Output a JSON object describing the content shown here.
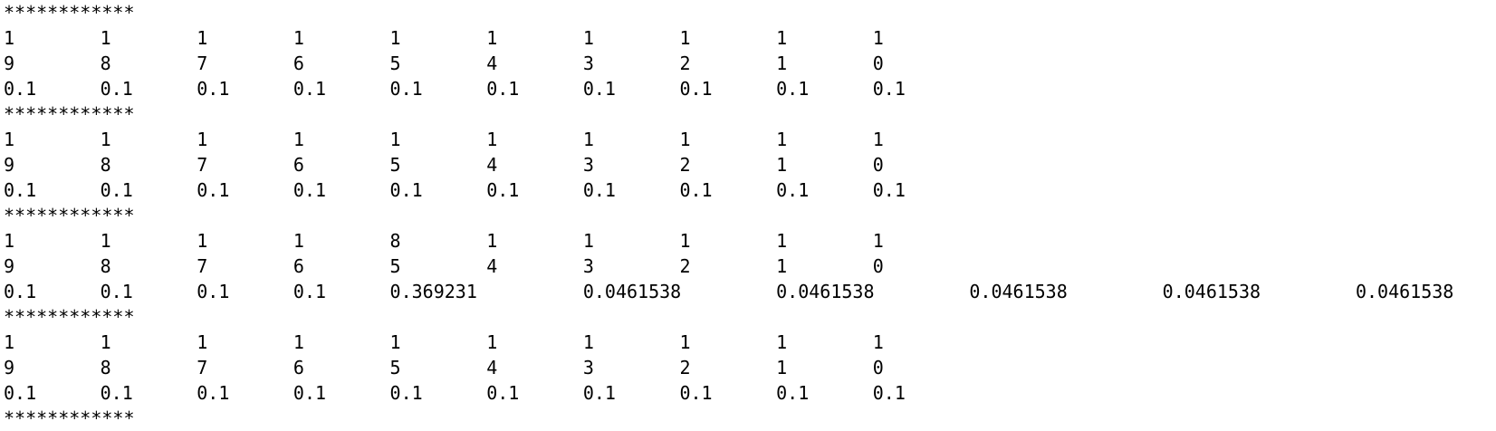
{
  "terminal": {
    "separator": "************",
    "blocks": [
      {
        "rows": [
          [
            "1",
            "1",
            "1",
            "1",
            "1",
            "1",
            "1",
            "1",
            "1",
            "1"
          ],
          [
            "9",
            "8",
            "7",
            "6",
            "5",
            "4",
            "3",
            "2",
            "1",
            "0"
          ],
          [
            "0.1",
            "0.1",
            "0.1",
            "0.1",
            "0.1",
            "0.1",
            "0.1",
            "0.1",
            "0.1",
            "0.1"
          ]
        ]
      },
      {
        "rows": [
          [
            "1",
            "1",
            "1",
            "1",
            "1",
            "1",
            "1",
            "1",
            "1",
            "1"
          ],
          [
            "9",
            "8",
            "7",
            "6",
            "5",
            "4",
            "3",
            "2",
            "1",
            "0"
          ],
          [
            "0.1",
            "0.1",
            "0.1",
            "0.1",
            "0.1",
            "0.1",
            "0.1",
            "0.1",
            "0.1",
            "0.1"
          ]
        ]
      },
      {
        "rows": [
          [
            "1",
            "1",
            "1",
            "1",
            "8",
            "1",
            "1",
            "1",
            "1",
            "1"
          ],
          [
            "9",
            "8",
            "7",
            "6",
            "5",
            "4",
            "3",
            "2",
            "1",
            "0"
          ],
          [
            "0.1",
            "0.1",
            "0.1",
            "0.1",
            "0.369231",
            "0.0461538",
            "0.0461538",
            "0.0461538",
            "0.0461538",
            "0.0461538"
          ]
        ]
      },
      {
        "rows": [
          [
            "1",
            "1",
            "1",
            "1",
            "1",
            "1",
            "1",
            "1",
            "1",
            "1"
          ],
          [
            "9",
            "8",
            "7",
            "6",
            "5",
            "4",
            "3",
            "2",
            "1",
            "0"
          ],
          [
            "0.1",
            "0.1",
            "0.1",
            "0.1",
            "0.1",
            "0.1",
            "0.1",
            "0.1",
            "0.1",
            "0.1"
          ]
        ]
      }
    ]
  }
}
